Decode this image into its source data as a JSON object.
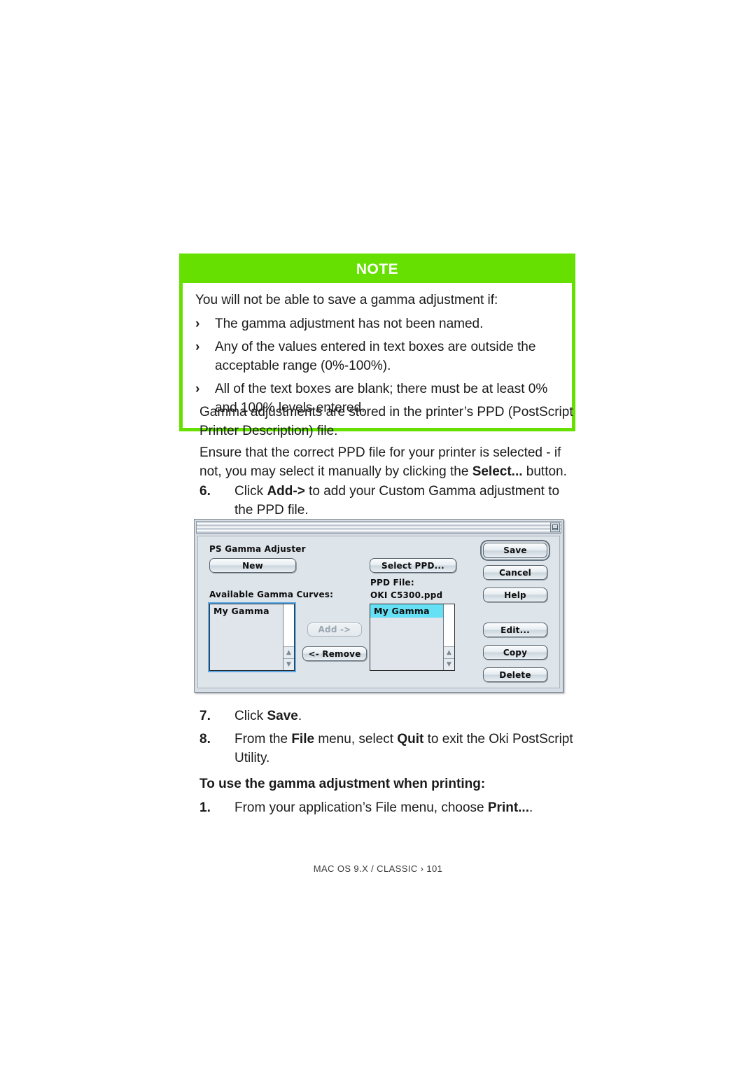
{
  "note": {
    "header": "NOTE",
    "lead": "You will not be able to save a gamma adjustment if:",
    "bullet_glyph": "›",
    "items": [
      "The gamma adjustment has not been named.",
      "Any of the values entered in text boxes are outside the acceptable range (0%-100%).",
      "All of the text boxes are blank; there must be at least 0% and 100% levels entered."
    ]
  },
  "body": {
    "paragraph_1": "Gamma adjustments are stored in the printer’s PPD (PostScript Printer Description) file.",
    "paragraph_2_part1": "Ensure that the correct PPD file for your printer is selected - if not, you may select it manually by clicking the ",
    "paragraph_2_bold": "Select...",
    "paragraph_2_part2": " button.",
    "step6_number": "6.",
    "step6_part1": "Click ",
    "step6_bold": "Add->",
    "step6_part2": " to add your Custom Gamma adjustment to the PPD file.",
    "step7_number": "7.",
    "step7_part1": "Click ",
    "step7_bold": "Save",
    "step7_part2": ".",
    "step8_number": "8.",
    "step8_part1": "From the ",
    "step8_bold1": "File",
    "step8_part2": " menu, select ",
    "step8_bold2": "Quit",
    "step8_part3": " to exit the Oki PostScript Utility.",
    "subheading": "To use the gamma adjustment when printing:",
    "step1b_number": "1.",
    "step1b_part1": "From your application’s File menu, choose ",
    "step1b_bold": "Print...",
    "step1b_part2": "."
  },
  "footer": {
    "text": "MAC OS 9.X / CLASSIC › 101"
  },
  "dialog": {
    "window_title": "",
    "collapse_icon": "windowshade-icon",
    "app_title": "PS Gamma Adjuster",
    "new_button": "New",
    "select_ppd_button": "Select PPD...",
    "ppd_file_label": "PPD File:",
    "ppd_file_value": "OKI C5300.ppd",
    "available_label": "Available Gamma Curves:",
    "available_list": [
      {
        "label": "My Gamma",
        "selected": false
      }
    ],
    "ppd_list": [
      {
        "label": "My Gamma",
        "selected": true
      }
    ],
    "add_button": "Add ->",
    "add_button_disabled": true,
    "remove_button": "<- Remove",
    "remove_button_disabled": false,
    "save_button": "Save",
    "save_is_default": true,
    "cancel_button": "Cancel",
    "help_button": "Help",
    "edit_button": "Edit...",
    "copy_button": "Copy",
    "delete_button": "Delete",
    "scroll_up_glyph": "▲",
    "scroll_down_glyph": "▼"
  },
  "colors": {
    "note_green": "#66e000",
    "selection_cyan": "#66e0f5",
    "focus_blue": "#56a8e8",
    "dialog_face": "#dde4ea"
  }
}
